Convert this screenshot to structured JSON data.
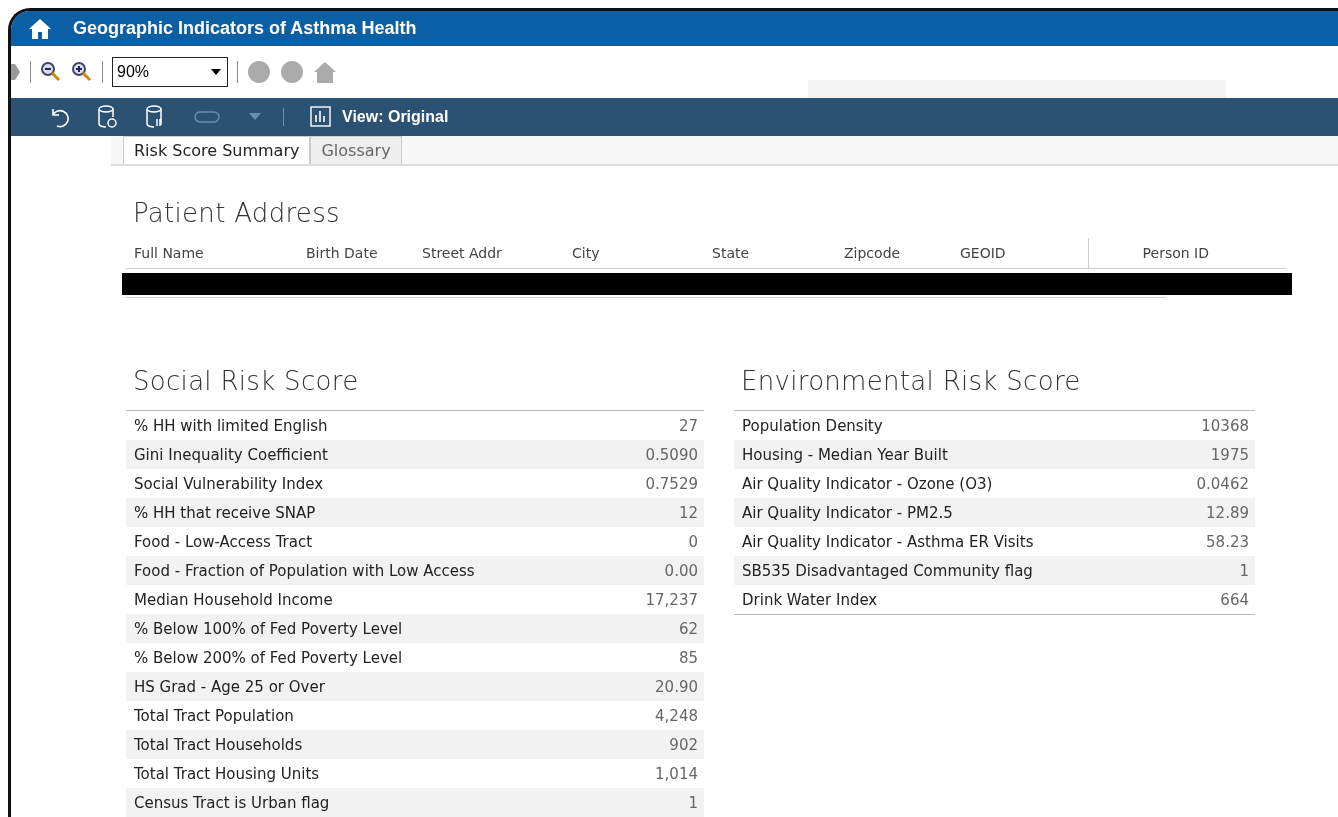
{
  "window": {
    "title": "Geographic Indicators of Asthma Health"
  },
  "toolbar": {
    "zoom": "90%"
  },
  "view_bar": {
    "view_label": "View: Original"
  },
  "tabs": [
    {
      "label": "Risk Score Summary",
      "selected": true
    },
    {
      "label": "Glossary",
      "selected": false
    }
  ],
  "patient_address": {
    "title": "Patient Address",
    "columns": [
      "Full Name",
      "Birth Date",
      "Street Addr",
      "City",
      "State",
      "Zipcode",
      "GEOID",
      "Person ID"
    ],
    "row_redacted": true
  },
  "social_risk": {
    "title": "Social Risk Score",
    "rows": [
      {
        "label": "% HH with limited English",
        "value": "27"
      },
      {
        "label": "Gini Inequality Coefficient",
        "value": "0.5090"
      },
      {
        "label": "Social Vulnerability Index",
        "value": "0.7529"
      },
      {
        "label": "% HH that receive SNAP",
        "value": "12"
      },
      {
        "label": "Food - Low-Access Tract",
        "value": "0"
      },
      {
        "label": "Food - Fraction of Population with Low Access",
        "value": "0.00"
      },
      {
        "label": "Median Household Income",
        "value": "17,237"
      },
      {
        "label": "% Below 100% of Fed Poverty Level",
        "value": "62"
      },
      {
        "label": "% Below 200% of Fed Poverty Level",
        "value": "85"
      },
      {
        "label": "HS Grad - Age 25 or Over",
        "value": "20.90"
      },
      {
        "label": "Total Tract Population",
        "value": "4,248"
      },
      {
        "label": "Total Tract Households",
        "value": "902"
      },
      {
        "label": "Total Tract Housing Units",
        "value": "1,014"
      },
      {
        "label": "Census Tract is Urban flag",
        "value": "1"
      }
    ]
  },
  "environmental_risk": {
    "title": "Environmental Risk Score",
    "rows": [
      {
        "label": "Population Density",
        "value": "10368"
      },
      {
        "label": "Housing - Median Year Built",
        "value": "1975"
      },
      {
        "label": "Air Quality Indicator - Ozone (O3)",
        "value": "0.0462"
      },
      {
        "label": "Air Quality Indicator - PM2.5",
        "value": "12.89"
      },
      {
        "label": "Air Quality Indicator - Asthma ER Visits",
        "value": "58.23"
      },
      {
        "label": "SB535 Disadvantaged Community flag",
        "value": "1"
      },
      {
        "label": "Drink Water Index",
        "value": "664"
      }
    ]
  }
}
